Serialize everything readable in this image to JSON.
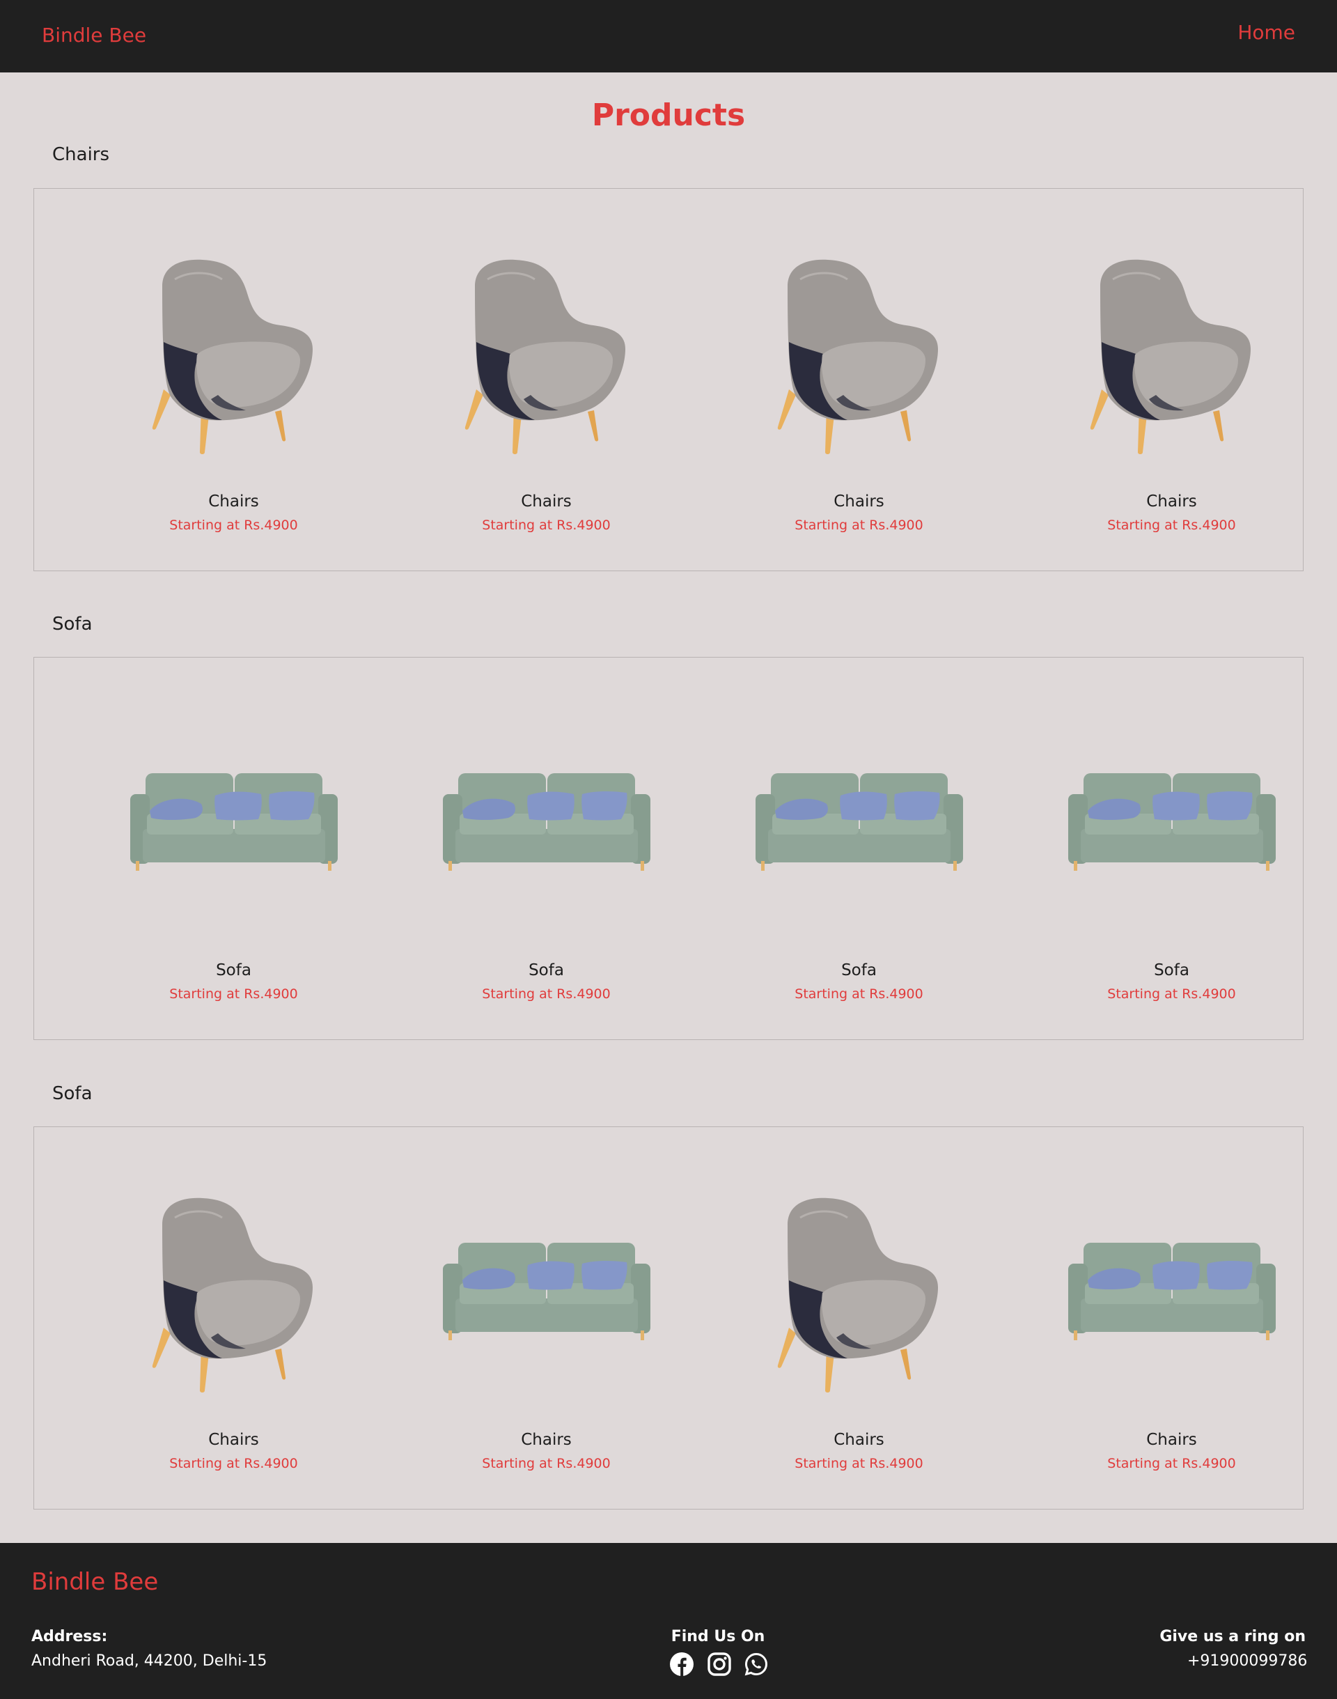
{
  "navbar": {
    "brand": "Bindle Bee",
    "home_link": "Home"
  },
  "page_title": "Products",
  "sections": [
    {
      "heading": "Chairs",
      "products": [
        {
          "name": "Chairs",
          "price": "Starting at Rs.4900",
          "image": "armchair"
        },
        {
          "name": "Chairs",
          "price": "Starting at Rs.4900",
          "image": "armchair"
        },
        {
          "name": "Chairs",
          "price": "Starting at Rs.4900",
          "image": "armchair"
        },
        {
          "name": "Chairs",
          "price": "Starting at Rs.4900",
          "image": "armchair"
        }
      ]
    },
    {
      "heading": "Sofa",
      "products": [
        {
          "name": "Sofa",
          "price": "Starting at Rs.4900",
          "image": "sofa"
        },
        {
          "name": "Sofa",
          "price": "Starting at Rs.4900",
          "image": "sofa"
        },
        {
          "name": "Sofa",
          "price": "Starting at Rs.4900",
          "image": "sofa"
        },
        {
          "name": "Sofa",
          "price": "Starting at Rs.4900",
          "image": "sofa"
        }
      ]
    },
    {
      "heading": "Sofa",
      "products": [
        {
          "name": "Chairs",
          "price": "Starting at Rs.4900",
          "image": "armchair"
        },
        {
          "name": "Chairs",
          "price": "Starting at Rs.4900",
          "image": "sofa"
        },
        {
          "name": "Chairs",
          "price": "Starting at Rs.4900",
          "image": "armchair"
        },
        {
          "name": "Chairs",
          "price": "Starting at Rs.4900",
          "image": "sofa"
        }
      ]
    }
  ],
  "footer": {
    "brand": "Bindle Bee",
    "address_label": "Address:",
    "address_value": "Andheri Road, 44200, Delhi-15",
    "find_us_label": "Find Us On",
    "social_icons": [
      "facebook-icon",
      "instagram-icon",
      "whatsapp-icon"
    ],
    "phone_label": "Give us a ring on",
    "phone_value": "+91900099786"
  },
  "colors": {
    "accent": "#e03c3c",
    "dark": "#202020",
    "page_background": "#dfd9d9"
  }
}
